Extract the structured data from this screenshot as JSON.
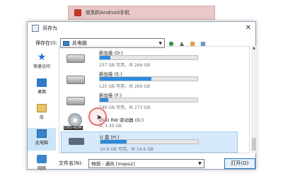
{
  "background_app": {
    "title": "收到的Android手机"
  },
  "dialog": {
    "title": "另存为",
    "save_in_label": "保存在(I):",
    "location": "此电脑",
    "sidebar": [
      {
        "label": "快速访问",
        "icon": "quick-access-star-icon"
      },
      {
        "label": "桌面",
        "icon": "desktop-icon"
      },
      {
        "label": "库",
        "icon": "library-icon"
      },
      {
        "label": "此电脑",
        "icon": "computer-icon",
        "selected": true
      },
      {
        "label": "网络",
        "icon": "network-icon"
      }
    ],
    "drives": [
      {
        "name": "新加卷 (D:)",
        "info": "237 GB 可用，共 266 GB",
        "used_fraction": 0.11,
        "type": "hdd"
      },
      {
        "name": "新加卷 (E:)",
        "info": "125 GB 可用，共 266 GB",
        "used_fraction": 0.53,
        "type": "hdd"
      },
      {
        "name": "新加卷 (F:)",
        "info": "249 GB 可用，共 273 GB",
        "used_fraction": 0.09,
        "type": "hdd"
      },
      {
        "name": "DVD RW 驱动器 (G:)",
        "info": "共 3.30 GB",
        "type": "dvd",
        "tag": "DVD-ROM"
      },
      {
        "name": "U 盘 (H:)",
        "info": "10.6 GB 可用，共 14.6 GB",
        "used_fraction": 0.27,
        "type": "usb",
        "highlighted": true
      }
    ],
    "filename_label": "文件名(N):",
    "filename_value": "畅想 - 通风 [mqes2]",
    "open_button": "打开(O)"
  }
}
